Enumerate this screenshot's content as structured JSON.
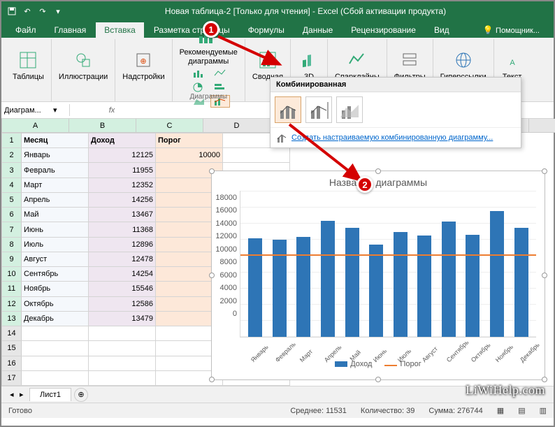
{
  "title": "Новая таблица-2  [Только для чтения] - Excel (Сбой активации продукта)",
  "tabs": [
    "Файл",
    "Главная",
    "Вставка",
    "Разметка страницы",
    "Формулы",
    "Данные",
    "Рецензирование",
    "Вид"
  ],
  "help_tab": "Помощник...",
  "active_tab": 2,
  "ribbon": {
    "tables": "Таблицы",
    "illustrations": "Иллюстрации",
    "addins": "Надстройки",
    "rec_charts": "Рекомендуемые\nдиаграммы",
    "charts_group": "Диаграммы",
    "pivot": "Сводная",
    "3d": "3D",
    "sparklines": "Спарклайны",
    "filters": "Фильтры",
    "links": "Гиперссылки",
    "text": "Текст"
  },
  "combo_dd": {
    "title": "Комбинированная",
    "custom_link": "Создать настраиваемую комбинированную диаграмму..."
  },
  "namebox": "Диаграм...",
  "headers": [
    "A",
    "B",
    "C",
    "D",
    "H"
  ],
  "table": {
    "h": [
      "Месяц",
      "Доход",
      "Порог"
    ],
    "rows": [
      [
        "Январь",
        12125,
        10000
      ],
      [
        "Февраль",
        11955,
        ""
      ],
      [
        "Март",
        12352,
        ""
      ],
      [
        "Апрель",
        14256,
        ""
      ],
      [
        "Май",
        13467,
        ""
      ],
      [
        "Июнь",
        11368,
        ""
      ],
      [
        "Июль",
        12896,
        ""
      ],
      [
        "Август",
        12478,
        ""
      ],
      [
        "Сентябрь",
        14254,
        ""
      ],
      [
        "Ноябрь",
        15546,
        ""
      ],
      [
        "Октябрь",
        12586,
        ""
      ],
      [
        "Декабрь",
        13479,
        ""
      ]
    ]
  },
  "chart_data": {
    "type": "combo",
    "title": "Название диаграммы",
    "categories": [
      "Январь",
      "Февраль",
      "Март",
      "Апрель",
      "Май",
      "Июнь",
      "Июль",
      "Август",
      "Сентябрь",
      "Октябрь",
      "Ноябрь",
      "Декабрь"
    ],
    "series": [
      {
        "name": "Доход",
        "type": "bar",
        "values": [
          12125,
          11955,
          12352,
          14256,
          13467,
          11368,
          12896,
          12478,
          14254,
          12586,
          15546,
          13479
        ]
      },
      {
        "name": "Порог",
        "type": "line",
        "values": [
          10000,
          10000,
          10000,
          10000,
          10000,
          10000,
          10000,
          10000,
          10000,
          10000,
          10000,
          10000
        ]
      }
    ],
    "ylim": [
      0,
      18000
    ],
    "yticks": [
      0,
      2000,
      4000,
      6000,
      8000,
      10000,
      12000,
      14000,
      16000,
      18000
    ]
  },
  "legend": {
    "s1": "Доход",
    "s2": "Порог"
  },
  "sheet_tab": "Лист1",
  "status": {
    "ready": "Готово",
    "avg_l": "Среднее:",
    "avg_v": "11531",
    "cnt_l": "Количество:",
    "cnt_v": "39",
    "sum_l": "Сумма:",
    "sum_v": "276744"
  },
  "watermark": "LiWiHelp.com",
  "callouts": {
    "c1": "1",
    "c2": "2"
  }
}
